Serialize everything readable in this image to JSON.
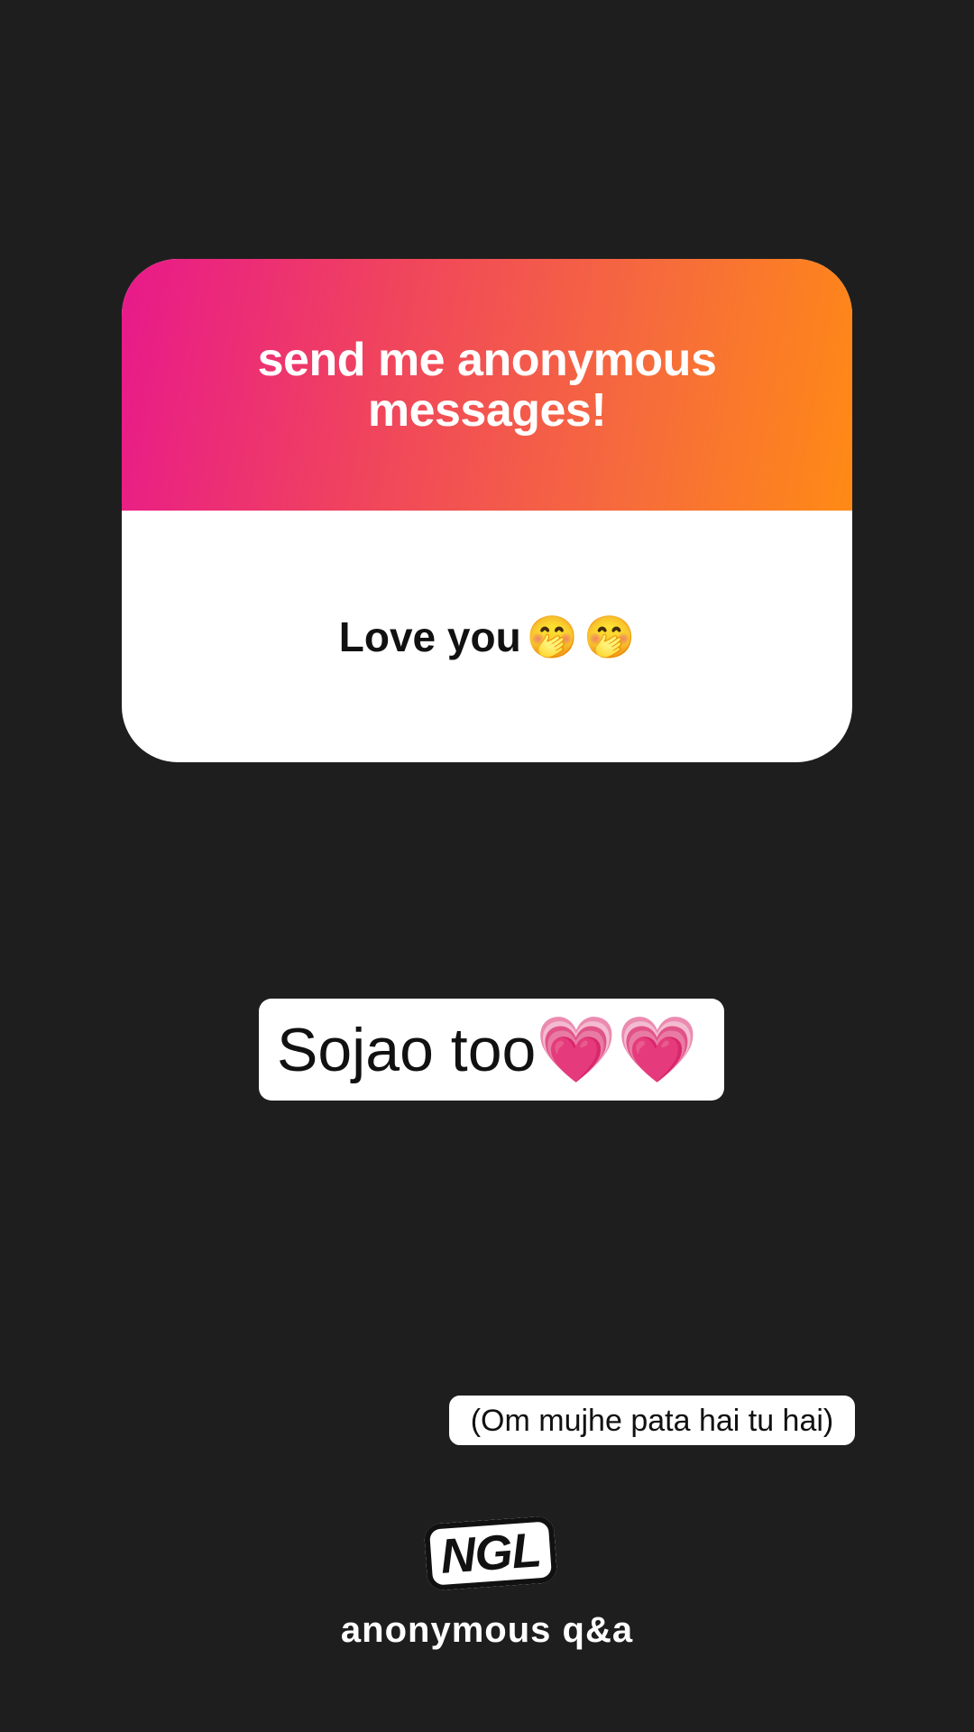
{
  "card": {
    "title": "send me anonymous messages!",
    "message": "Love you",
    "emojis": [
      "🤭",
      "🤭"
    ],
    "gradient_colors": [
      "#e8198b",
      "#ff8a15"
    ]
  },
  "reply": {
    "text": "Sojao too",
    "emojis": [
      "💗",
      "💗"
    ]
  },
  "note": {
    "text": "(Om mujhe pata hai tu hai)"
  },
  "footer": {
    "logo": "NGL",
    "tagline": "anonymous q&a"
  },
  "colors": {
    "background": "#1e1e1e",
    "card_body": "#ffffff",
    "text_dark": "#111111",
    "text_light": "#ffffff"
  }
}
